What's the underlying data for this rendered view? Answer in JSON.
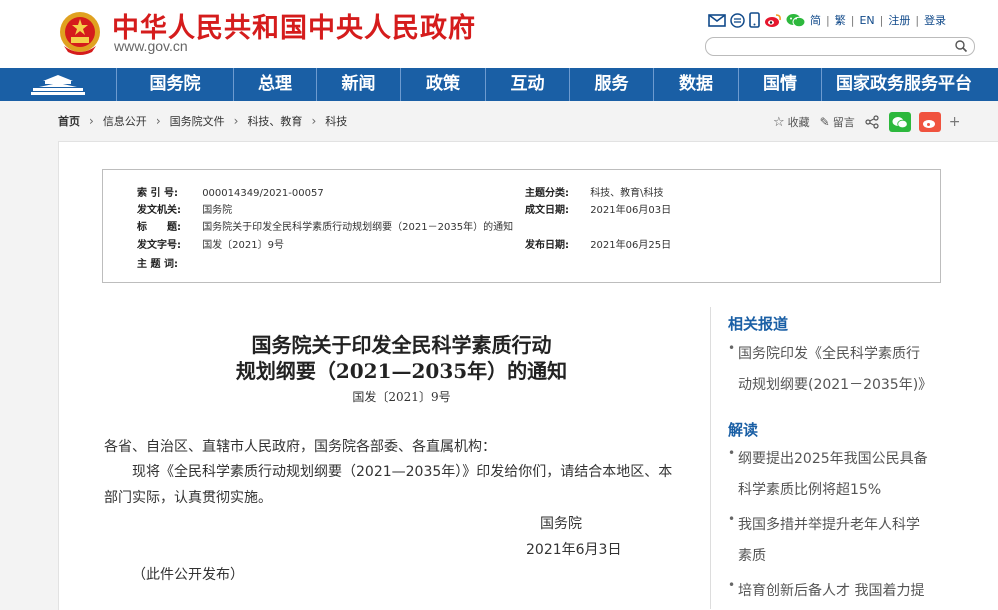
{
  "header": {
    "title": "中华人民共和国中央人民政府",
    "domain": "www.gov.cn",
    "tools": {
      "icons": [
        "mail-icon",
        "list-icon",
        "mobile-icon",
        "weibo-icon",
        "wechat-icon"
      ],
      "links": [
        "简",
        "繁",
        "EN",
        "注册",
        "登录"
      ]
    },
    "search": {
      "placeholder": ""
    }
  },
  "nav": {
    "items": [
      "国务院",
      "总理",
      "新闻",
      "政策",
      "互动",
      "服务",
      "数据",
      "国情",
      "国家政务服务平台"
    ]
  },
  "breadcrumb": [
    "首页",
    "信息公开",
    "国务院文件",
    "科技、教育",
    "科技"
  ],
  "share": {
    "favorite": "收藏",
    "comment": "留言",
    "plus": "+"
  },
  "info": {
    "labels": {
      "index": "索 引 号:",
      "issuer": "发文机关:",
      "title": "标　　题:",
      "docno": "发文字号:",
      "subject": "主 题 词:",
      "category": "主题分类:",
      "date_written": "成文日期:",
      "date_published": "发布日期:"
    },
    "values": {
      "index": "000014349/2021-00057",
      "issuer": "国务院",
      "title": "国务院关于印发全民科学素质行动规划纲要（2021－2035年）的通知",
      "docno": "国发〔2021〕9号",
      "subject": "",
      "category": "科技、教育\\科技",
      "date_written": "2021年06月03日",
      "date_published": "2021年06月25日"
    }
  },
  "article": {
    "title_line1": "国务院关于印发全民科学素质行动",
    "title_line2": "规划纲要（2021—2035年）的通知",
    "docno": "国发〔2021〕9号",
    "salutation": "各省、自治区、直辖市人民政府，国务院各部委、各直属机构：",
    "body_line1": "现将《全民科学素质行动规划纲要（2021—2035年）》印发给你们，请结合本地区、本",
    "body_line2": "部门实际，认真贯彻实施。",
    "signature": "国务院",
    "sign_date": "2021年6月3日",
    "note": "（此件公开发布）"
  },
  "sidebar": {
    "related_heading": "相关报道",
    "related": [
      {
        "line1": "国务院印发《全民科学素质行",
        "line2": "动规划纲要(2021－2035年)》"
      }
    ],
    "interpret_heading": "解读",
    "interpret": [
      {
        "line1": "纲要提出2025年我国公民具备",
        "line2": "科学素质比例将超15%"
      },
      {
        "line1": "我国多措并举提升老年人科学",
        "line2": "素质"
      },
      {
        "line1": "培育创新后备人才 我国着力提",
        "line2": ""
      }
    ]
  },
  "colors": {
    "brand_red": "#d51c1c",
    "nav_blue": "#1a5fa5",
    "link_blue": "#114a8a"
  }
}
